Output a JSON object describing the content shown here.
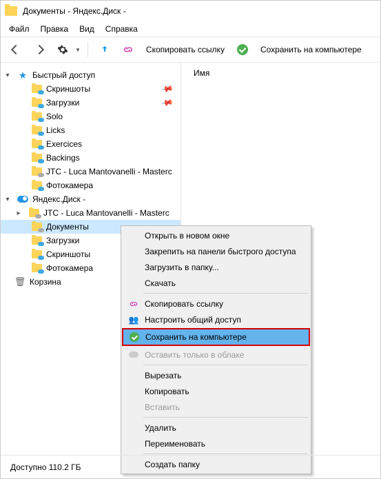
{
  "title": "Документы - Яндекс.Диск -",
  "menu": {
    "file": "Файл",
    "edit": "Правка",
    "view": "Вид",
    "help": "Справка"
  },
  "toolbar": {
    "copyLink": "Скопировать ссылку",
    "saveLocal": "Сохранить на компьютере"
  },
  "listHeader": {
    "name": "Имя"
  },
  "tree": {
    "quickAccess": "Быстрый доступ",
    "items1": {
      "screenshots": "Скриншоты",
      "downloads": "Загрузки",
      "solo": "Solo",
      "licks": "Licks",
      "exercices": "Exercices",
      "backings": "Backings",
      "jtc": "JTC - Luca Mantovanelli - Masterc",
      "photo": "Фотокамера"
    },
    "yandexDisk": "Яндекс.Диск -",
    "items2": {
      "jtc": "JTC - Luca Mantovanelli - Masterc",
      "documents": "Документы",
      "downloads": "Загрузки",
      "screenshots": "Скриншоты",
      "photo": "Фотокамера"
    },
    "trash": "Корзина"
  },
  "ctx": {
    "openNew": "Открыть в новом окне",
    "pinQuick": "Закрепить на панели быстрого доступа",
    "uploadTo": "Загрузить в папку...",
    "download": "Скачать",
    "copyLink": "Скопировать ссылку",
    "configShare": "Настроить общий доступ",
    "saveLocal": "Сохранить на компьютере",
    "cloudOnly": "Оставить только в облаке",
    "cut": "Вырезать",
    "copy": "Копировать",
    "paste": "Вставить",
    "delete": "Удалить",
    "rename": "Переименовать",
    "newFolder": "Создать папку"
  },
  "status": {
    "available": "Доступно 110.2 ГБ"
  }
}
